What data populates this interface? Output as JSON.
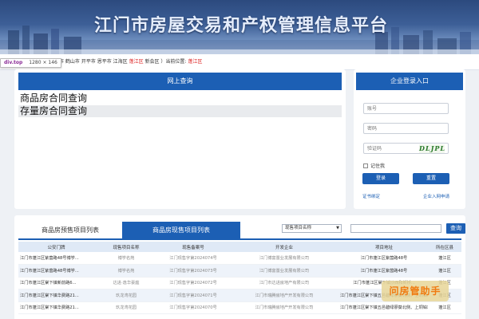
{
  "banner": {
    "title": "江门市房屋交易和产权管理信息平台"
  },
  "devtools_tip": {
    "tag": "div.top",
    "size": "1280 × 146"
  },
  "location": {
    "cities_text": "台山市 鹤山市 开平市 恩平市 江海区",
    "current_city": "蓬江区",
    "more_text": "新会区 ）当前位置:",
    "current_position": "蓬江区"
  },
  "query_panel": {
    "title": "网上查询",
    "links": [
      "商品房合同查询",
      "存量房合同查询"
    ]
  },
  "login_panel": {
    "title": "企业登录入口",
    "account_placeholder": "账号",
    "password_placeholder": "密码",
    "captcha_placeholder": "验证码",
    "captcha_text": "DLJPL",
    "remember_label": "记住我",
    "login_button": "登录",
    "reset_button": "重置",
    "cert_link": "证书绑定",
    "apply_link": "企业入网申请"
  },
  "projects": {
    "tabs": [
      "商品房预售项目列表",
      "商品房现售项目列表"
    ],
    "active_tab": 1,
    "search_select": "现售项目名称",
    "search_button": "查询",
    "columns": [
      "公安门牌",
      "现售项目名称",
      "现售备案号",
      "开发企业",
      "项目地址",
      "所在区县"
    ],
    "rows": [
      [
        "江门市蓬江区紫茵路48号博学...",
        "博学名苑",
        "江门现售字第2024074号",
        "江门博富置业发展有限公司",
        "江门市蓬江区紫茵路48号",
        "蓬江区"
      ],
      [
        "江门市蓬江区紫茵路48号博学...",
        "博学名苑",
        "江门现售字第2024073号",
        "江门博富置业发展有限公司",
        "江门市蓬江区紫茵路48号",
        "蓬江区"
      ],
      [
        "江门市蓬江区棠下镇新前路6...",
        "达进·逸华豪庭",
        "江门现售字第2024072号",
        "江门市达进房地产有限公司",
        "江门市蓬江区棠下镇沙西和新桥...",
        "蓬江区"
      ],
      [
        "江门市蓬江区棠下镇华费路21...",
        "玖龙湾花园",
        "江门现售字第2024071号",
        "江门市瑞腾房地产开发有限公司",
        "江门市蓬江区棠下镇五邑碧绿廖葵北侧、上垌铂地汇...",
        "蓬江区"
      ],
      [
        "江门市蓬江区棠下镇华费路21...",
        "玖龙湾花园",
        "江门现售字第2024070号",
        "江门市瑞腾房地产开发有限公司",
        "江门市蓬江区棠下镇五邑碧绿廖葵北侧、上垌铂地汇...",
        "蓬江区"
      ]
    ]
  },
  "watermark": "问房管助手",
  "colors": {
    "primary": "#1c5fb4",
    "highlight": "#d22222",
    "page_bg": "#eef1f5"
  }
}
